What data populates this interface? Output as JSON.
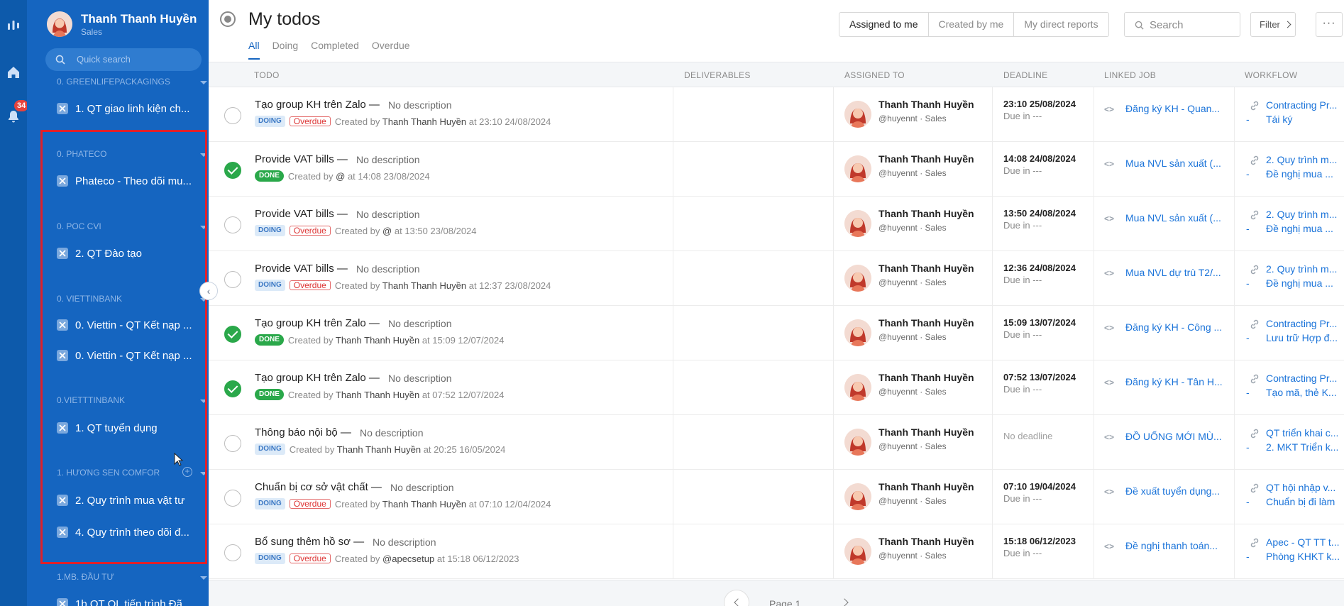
{
  "rail": {
    "badge": "34"
  },
  "sidebar": {
    "profile": {
      "name": "Thanh Thanh Huyền",
      "role": "Sales"
    },
    "search_placeholder": "Quick search",
    "groups": [
      {
        "label": "0. GREENLIFEPACKAGINGS",
        "items": [
          "1. QT giao linh kiện ch..."
        ]
      },
      {
        "label": "0. PHATECO",
        "items": [
          "Phateco - Theo dõi mu..."
        ]
      },
      {
        "label": "0. POC CVI",
        "items": [
          "2. QT Đào tạo"
        ]
      },
      {
        "label": "0. VIETTINBANK",
        "items": [
          "0. Viettin - QT Kết nạp ...",
          "0. Viettin - QT Kết nạp ..."
        ]
      },
      {
        "label": "0.VIETTTINBANK",
        "items": [
          "1. QT tuyển dụng"
        ]
      },
      {
        "label": "1. HƯƠNG SEN COMFOR",
        "items": [
          "2. Quy trình mua vật tư",
          "4. Quy trình theo dõi đ..."
        ]
      },
      {
        "label": "1.MB. ĐẦU TƯ",
        "items": [
          "1b QT QL tiến trình Đã..."
        ]
      }
    ]
  },
  "header": {
    "title": "My todos",
    "tabs": [
      "All",
      "Doing",
      "Completed",
      "Overdue"
    ],
    "segments": [
      "Assigned to me",
      "Created by me",
      "My direct reports"
    ],
    "search_placeholder": "Search",
    "filter_label": "Filter",
    "more_label": "···"
  },
  "table": {
    "columns": [
      "TODO",
      "DELIVERABLES",
      "ASSIGNED TO",
      "DEADLINE",
      "LINKED JOB",
      "WORKFLOW"
    ],
    "rows": [
      {
        "done": false,
        "title": "Tạo group KH trên Zalo —",
        "desc": "No description",
        "status": "DOING",
        "overdue": "Overdue",
        "created_prefix": "Created by",
        "creator": "Thanh Thanh Huyền",
        "created_suffix": "at 23:10 24/08/2024",
        "assignee": "Thanh Thanh Huyền",
        "assignee_sub": "@huyennt · Sales",
        "deadline": "23:10 25/08/2024",
        "due": "Due in ---",
        "linked_job": "Đăng ký KH - Quan...",
        "wf_main": "Contracting Pr...",
        "wf_sub": "Tái ký"
      },
      {
        "done": true,
        "title": "Provide VAT bills —",
        "desc": "No description",
        "status": "DONE",
        "overdue": "",
        "created_prefix": "Created by",
        "creator": "@",
        "created_suffix": "at 14:08 23/08/2024",
        "assignee": "Thanh Thanh Huyền",
        "assignee_sub": "@huyennt · Sales",
        "deadline": "14:08 24/08/2024",
        "due": "Due in ---",
        "linked_job": "Mua NVL sản xuất (...",
        "wf_main": "2. Quy trình m...",
        "wf_sub": "Đề nghị mua ..."
      },
      {
        "done": false,
        "title": "Provide VAT bills —",
        "desc": "No description",
        "status": "DOING",
        "overdue": "Overdue",
        "created_prefix": "Created by",
        "creator": "@",
        "created_suffix": "at 13:50 23/08/2024",
        "assignee": "Thanh Thanh Huyền",
        "assignee_sub": "@huyennt · Sales",
        "deadline": "13:50 24/08/2024",
        "due": "Due in ---",
        "linked_job": "Mua NVL sản xuất (...",
        "wf_main": "2. Quy trình m...",
        "wf_sub": "Đề nghị mua ..."
      },
      {
        "done": false,
        "title": "Provide VAT bills —",
        "desc": "No description",
        "status": "DOING",
        "overdue": "Overdue",
        "created_prefix": "Created by",
        "creator": "Thanh Thanh Huyền",
        "created_suffix": "at 12:37 23/08/2024",
        "assignee": "Thanh Thanh Huyền",
        "assignee_sub": "@huyennt · Sales",
        "deadline": "12:36 24/08/2024",
        "due": "Due in ---",
        "linked_job": "Mua NVL dự trù T2/...",
        "wf_main": "2. Quy trình m...",
        "wf_sub": "Đề nghị mua ..."
      },
      {
        "done": true,
        "title": "Tạo group KH trên Zalo —",
        "desc": "No description",
        "status": "DONE",
        "overdue": "",
        "created_prefix": "Created by",
        "creator": "Thanh Thanh Huyền",
        "created_suffix": "at 15:09 12/07/2024",
        "assignee": "Thanh Thanh Huyền",
        "assignee_sub": "@huyennt · Sales",
        "deadline": "15:09 13/07/2024",
        "due": "Due in ---",
        "linked_job": "Đăng ký KH - Công ...",
        "wf_main": "Contracting Pr...",
        "wf_sub": "Lưu trữ Hợp đ..."
      },
      {
        "done": true,
        "title": "Tạo group KH trên Zalo —",
        "desc": "No description",
        "status": "DONE",
        "overdue": "",
        "created_prefix": "Created by",
        "creator": "Thanh Thanh Huyền",
        "created_suffix": "at 07:52 12/07/2024",
        "assignee": "Thanh Thanh Huyền",
        "assignee_sub": "@huyennt · Sales",
        "deadline": "07:52 13/07/2024",
        "due": "Due in ---",
        "linked_job": "Đăng ký KH - Tân H...",
        "wf_main": "Contracting Pr...",
        "wf_sub": "Tạo mã, thẻ K..."
      },
      {
        "done": false,
        "title": "Thông báo nội bộ —",
        "desc": "No description",
        "status": "DOING",
        "overdue": "",
        "created_prefix": "Created by",
        "creator": "Thanh Thanh Huyền",
        "created_suffix": "at 20:25 16/05/2024",
        "assignee": "Thanh Thanh Huyền",
        "assignee_sub": "@huyennt · Sales",
        "deadline": "",
        "no_deadline": "No deadline",
        "due": "",
        "linked_job": "ĐỒ UỐNG MỚI MÙ...",
        "wf_main": "QT triển khai c...",
        "wf_sub": "2. MKT Triển k..."
      },
      {
        "done": false,
        "title": "Chuẩn bị cơ sở vật chất —",
        "desc": "No description",
        "status": "DOING",
        "overdue": "Overdue",
        "created_prefix": "Created by",
        "creator": "Thanh Thanh Huyền",
        "created_suffix": "at 07:10 12/04/2024",
        "assignee": "Thanh Thanh Huyền",
        "assignee_sub": "@huyennt · Sales",
        "deadline": "07:10 19/04/2024",
        "due": "Due in ---",
        "linked_job": "Đề xuất tuyển dụng...",
        "wf_main": "QT hội nhập v...",
        "wf_sub": "Chuẩn bị đi làm"
      },
      {
        "done": false,
        "title": "Bổ sung thêm hồ sơ —",
        "desc": "No description",
        "status": "DOING",
        "overdue": "Overdue",
        "created_prefix": "Created by",
        "creator": "@apecsetup",
        "created_suffix": "at 15:18 06/12/2023",
        "assignee": "Thanh Thanh Huyền",
        "assignee_sub": "@huyennt · Sales",
        "deadline": "15:18 06/12/2023",
        "due": "Due in ---",
        "linked_job": "Đề nghị thanh toán...",
        "wf_main": "Apec - QT TT t...",
        "wf_sub": "Phòng KHKT k..."
      }
    ]
  },
  "pagination": {
    "label": "Page 1"
  },
  "colors": {
    "rail": "#0d5aab",
    "sidebar": "#1565c0",
    "accent": "#1565c0",
    "done": "#2aa84a",
    "overdue": "#d33333",
    "link": "#1a73d9"
  }
}
